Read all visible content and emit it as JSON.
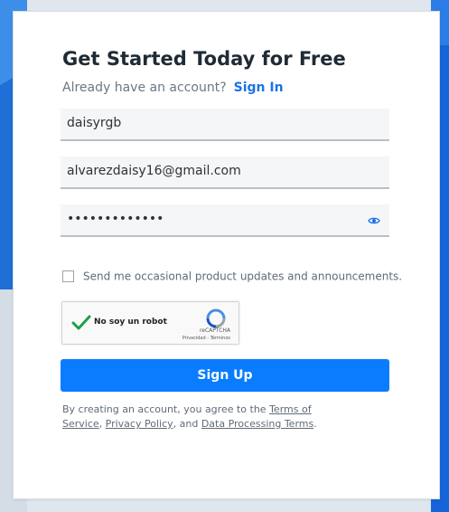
{
  "form": {
    "title": "Get Started Today for Free",
    "signin_prompt": "Already have an account?",
    "signin_link": "Sign In",
    "username_value": "daisyrgb",
    "email_value": "alvarezdaisy16@gmail.com",
    "password_value": "•••••••••••••",
    "updates_checkbox_label": "Send me occasional product updates and announcements.",
    "updates_checked": false,
    "submit_label": "Sign Up"
  },
  "recaptcha": {
    "label": "No soy un robot",
    "brand": "reCAPTCHA",
    "links": "Privacidad - Términos",
    "checked": true
  },
  "terms": {
    "prefix": "By creating an account, you agree to the",
    "tos": "Terms of Service",
    "comma": ",",
    "privacy": "Privacy Policy",
    "and": ", and",
    "dpt": "Data Processing Terms",
    "period": "."
  },
  "colors": {
    "accent": "#0a7cff",
    "link": "#1a73e8",
    "check": "#1e9e4a"
  }
}
